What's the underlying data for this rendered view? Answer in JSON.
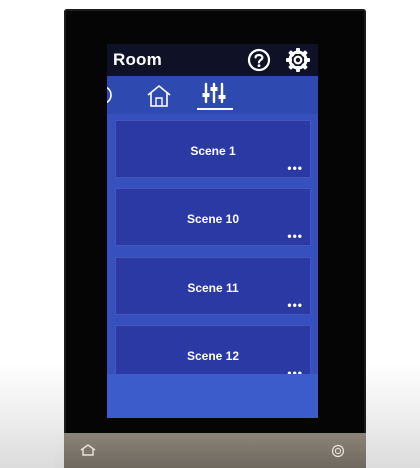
{
  "header": {
    "title": "Room"
  },
  "icons": {
    "help": "question-circle",
    "settings": "gear",
    "home_tab": "house",
    "scenes_tab": "sliders",
    "hw_home": "house-outline",
    "hw_power": "power"
  },
  "scenes": [
    {
      "label": "Scene 1",
      "more": "•••"
    },
    {
      "label": "Scene 10",
      "more": "•••"
    },
    {
      "label": "Scene 11",
      "more": "•••"
    },
    {
      "label": "Scene 12",
      "more": "•••"
    }
  ],
  "colors": {
    "header_bg": "#0f1226",
    "screen_bg": "#2f4fb8",
    "card_bg": "#2a39a4",
    "active_tab_underline": "#ffffff"
  }
}
